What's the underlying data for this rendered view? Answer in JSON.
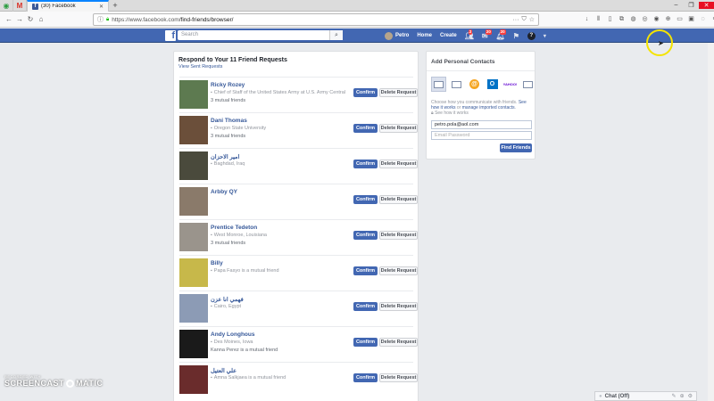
{
  "browser": {
    "tab_title": "(30) Facebook",
    "url_host": "https://www.facebook.com",
    "url_path": "/find-friends/browser/"
  },
  "fb_header": {
    "logo": "f",
    "search_placeholder": "Search",
    "profile_name": "Petro",
    "home": "Home",
    "create": "Create",
    "friend_badge": "2",
    "messages_badge": "20",
    "notif_badge": "20"
  },
  "requests": {
    "title": "Respond to Your 11 Friend Requests",
    "sent_link": "View Sent Requests",
    "confirm_label": "Confirm",
    "delete_label": "Delete Request",
    "items": [
      {
        "name": "Ricky Rozey",
        "line1": "Chief of Staff of the United States Army at U.S. Army Central",
        "line2": "3 mutual friends",
        "photo": "#5d7a50"
      },
      {
        "name": "Dani Thomas",
        "line1": "Oregon State University",
        "line2": "3 mutual friends",
        "photo": "#6b4f3a"
      },
      {
        "name": "امير الاحزان",
        "line1": "Baghdad, Iraq",
        "line2": "",
        "photo": "#4a4a3c"
      },
      {
        "name": "Arbby QY",
        "line1": "",
        "line2": "",
        "photo": "#8a7a6a"
      },
      {
        "name": "Prentice Tedeton",
        "line1": "West Monroe, Louisiana",
        "line2": "3 mutual friends",
        "photo": "#9a948c"
      },
      {
        "name": "Billy",
        "line1": "Papa Fasyo is a mutual friend",
        "line2": "",
        "photo": "#c7b84a"
      },
      {
        "name": "فهمي انا عزن",
        "line1": "Cairo, Egypt",
        "line2": "",
        "photo": "#8c9bb5"
      },
      {
        "name": "Andy Longhous",
        "line1": "Des Moines, Iowa",
        "line2": "Kanna Perez is a mutual friend",
        "photo": "#1a1a1a"
      },
      {
        "name": "علي العتيل",
        "line1": "Amna Salkjaea is a mutual friend",
        "line2": "",
        "photo": "#6a2c2c"
      }
    ]
  },
  "contacts": {
    "title": "Add Personal Contacts",
    "desc_a": "Choose how you communicate with friends. ",
    "desc_link1": "See how it works",
    "desc_b": " or ",
    "desc_link2": "manage imported contacts",
    "desc_c": ".",
    "desc_lock": "See how it works",
    "yahoo_label": "YAHOO!",
    "email_value": "petro.pola@aol.com",
    "password_placeholder": "Email Password",
    "find_button": "Find Friends"
  },
  "chat": {
    "label": "Chat (Off)"
  },
  "watermark": {
    "small": "RECORDED WITH",
    "big_a": "SCREENCAST",
    "big_b": "MATIC"
  },
  "colors": {
    "fb_blue": "#4267b2",
    "link": "#365899",
    "page_bg": "#e9ebee"
  }
}
